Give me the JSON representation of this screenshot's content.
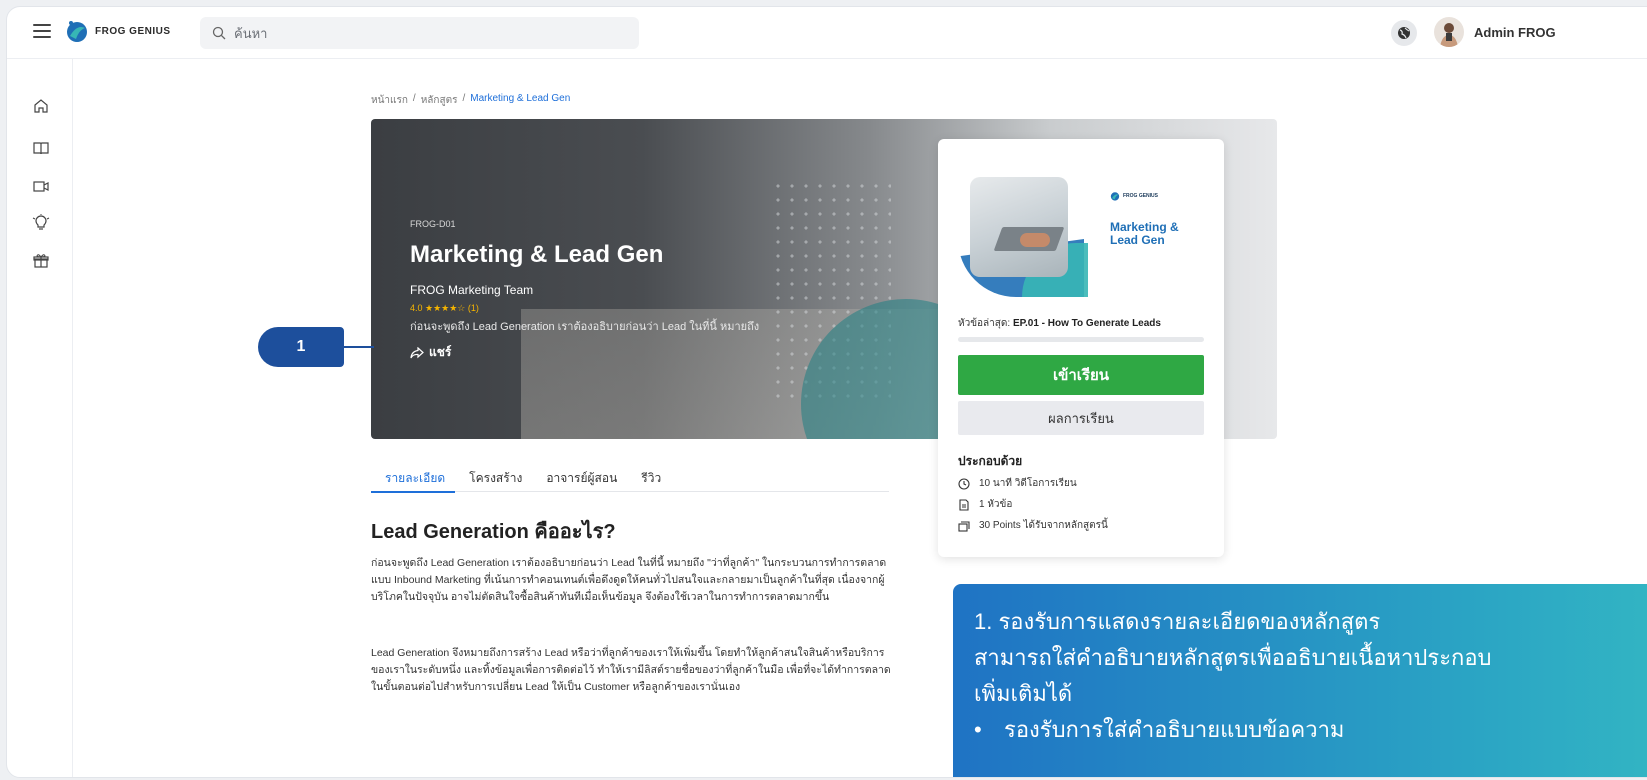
{
  "header": {
    "brand": "FROG GENIUS",
    "search_placeholder": "ค้นหา",
    "username": "Admin FROG"
  },
  "sidebar": {
    "icons": [
      "home-icon",
      "book-icon",
      "video-icon",
      "lightbulb-icon",
      "gift-icon"
    ]
  },
  "breadcrumb": {
    "home": "หน้าแรก",
    "sep1": "/",
    "courses": "หลักสูตร",
    "sep2": "/",
    "current": "Marketing & Lead Gen"
  },
  "hero": {
    "code": "FROG-D01",
    "title": "Marketing & Lead Gen",
    "team": "FROG Marketing Team",
    "rating": "4.0 ★★★★☆ (1)",
    "description": "ก่อนจะพูดถึง Lead Generation เราต้องอธิบายก่อนว่า Lead ในที่นี้ หมายถึง",
    "share": "แชร์"
  },
  "card": {
    "thumb_brand": "FROG GENIUS",
    "thumb_title_1": "Marketing &",
    "thumb_title_2": "Lead Gen",
    "latest_label": "หัวข้อล่าสุด:",
    "latest_value": "EP.01 - How To Generate Leads",
    "progress": 0,
    "enter_button": "เข้าเรียน",
    "result_button": "ผลการเรียน",
    "includes_title": "ประกอบด้วย",
    "includes": [
      "10 นาที วิดีโอการเรียน",
      "1 หัวข้อ",
      "30 Points ได้รับจากหลักสูตรนี้"
    ]
  },
  "tabs": [
    "รายละเอียด",
    "โครงสร้าง",
    "อาจารย์ผู้สอน",
    "รีวิว"
  ],
  "article": {
    "title": "Lead Generation คืออะไร?",
    "p1": "ก่อนจะพูดถึง Lead Generation เราต้องอธิบายก่อนว่า Lead ในที่นี้ หมายถึง \"ว่าที่ลูกค้า\" ในกระบวนการทำการตลาดแบบ Inbound Marketing ที่เน้นการทำคอนเทนต์เพื่อดึงดูดให้คนทั่วไปสนใจและกลายมาเป็นลูกค้าในที่สุด เนื่องจากผู้บริโภคในปัจจุบัน อาจไม่ตัดสินใจซื้อสินค้าทันทีเมื่อเห็นข้อมูล จึงต้องใช้เวลาในการทำการตลาดมากขึ้น",
    "p2": "Lead Generation จึงหมายถึงการสร้าง Lead หรือว่าที่ลูกค้าของเราให้เพิ่มขึ้น โดยทำให้ลูกค้าสนใจสินค้าหรือบริการของเราในระดับหนึ่ง และทิ้งข้อมูลเพื่อการติดต่อไว้ ทำให้เรามีลิสต์รายชื่อของว่าที่ลูกค้าในมือ เพื่อที่จะได้ทำการตลาดในขั้นตอนต่อไปสำหรับการเปลี่ยน Lead ให้เป็น Customer หรือลูกค้าของเรานั่นเอง"
  },
  "callout": {
    "marker": "1",
    "line1": "1. รองรับการแสดงรายละเอียดของหลักสูตร",
    "line2": "สามารถใส่คำอธิบายหลักสูตรเพื่ออธิบายเนื้อหาประกอบ",
    "line3": "เพิ่มเติมได้",
    "bullet": "รองรับการใส่คำอธิบายแบบข้อความ"
  },
  "colors": {
    "primary": "#1e6fd9",
    "enter_button": "#2fa844",
    "marker": "#1d4f9c",
    "rating_star": "#f5b400"
  }
}
